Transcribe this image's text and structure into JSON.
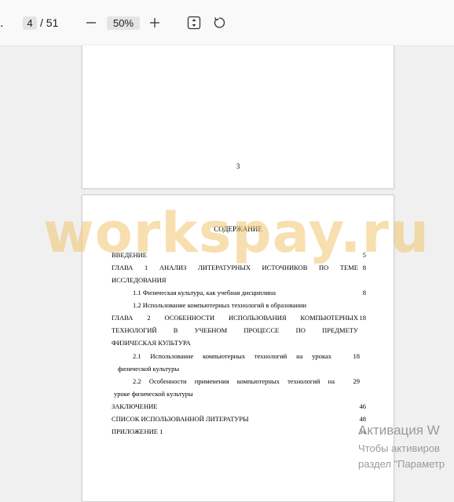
{
  "toolbar": {
    "left_fragment": ".",
    "current_page": "4",
    "page_total": "/ 51",
    "zoom": "50%",
    "icons": [
      "zoom-out-icon",
      "zoom-in-icon",
      "fit-page-icon",
      "rotate-icon"
    ]
  },
  "page_prev": {
    "page_number": "3"
  },
  "toc": {
    "title": "СОДЕРЖАНИЕ",
    "entries": [
      {
        "text": "ВВЕДЕНИЕ",
        "page": "5"
      },
      {
        "text": "ГЛАВА 1 АНАЛИЗ ЛИТЕРАТУРНЫХ ИСТОЧНИКОВ ПО ТЕМЕ",
        "page": "8"
      },
      {
        "text": "ИССЛЕДОВАНИЯ",
        "page": ""
      },
      {
        "text": "1.1 Физическая культура, как учебная дисциплина",
        "page": "8"
      },
      {
        "text": "1.2 Использование компьютерных технологий в образовании",
        "page": ""
      },
      {
        "text": "ГЛАВА 2 ОСОБЕННОСТИ ИСПОЛЬЗОВАНИЯ КОМПЬЮТЕРНЫХ",
        "page": "18"
      },
      {
        "text": "ТЕХНОЛОГИЙ В УЧЕБНОМ ПРОЦЕССЕ ПО ПРЕДМЕТУ",
        "page": ""
      },
      {
        "text": "ФИЗИЧЕСКАЯ КУЛЬТУРА",
        "page": ""
      },
      {
        "text": "2.1 Использование компьютерных технологий на уроках",
        "page": "18"
      },
      {
        "text": "физической культуры",
        "page": ""
      },
      {
        "text": "2.2 Особенности применения компьютерных технологий на",
        "page": "29"
      },
      {
        "text": "уроке физической культуры",
        "page": ""
      },
      {
        "text": "ЗАКЛЮЧЕНИЕ",
        "page": "46"
      },
      {
        "text": "СПИСОК ИСПОЛЬЗОВАННОЙ ЛИТЕРАТУРЫ",
        "page": "48"
      },
      {
        "text": "ПРИЛОЖЕНИЕ 1",
        "page": "51"
      }
    ]
  },
  "watermark": "workspay.ru",
  "activation": {
    "line1": "Активация W",
    "line2": "Чтобы активиров",
    "line3": "раздел \"Параметр"
  },
  "colors": {
    "watermark": "#f0c46e",
    "toolbar_bg": "#f9f9f9",
    "viewer_bg": "#f0f0f0"
  }
}
